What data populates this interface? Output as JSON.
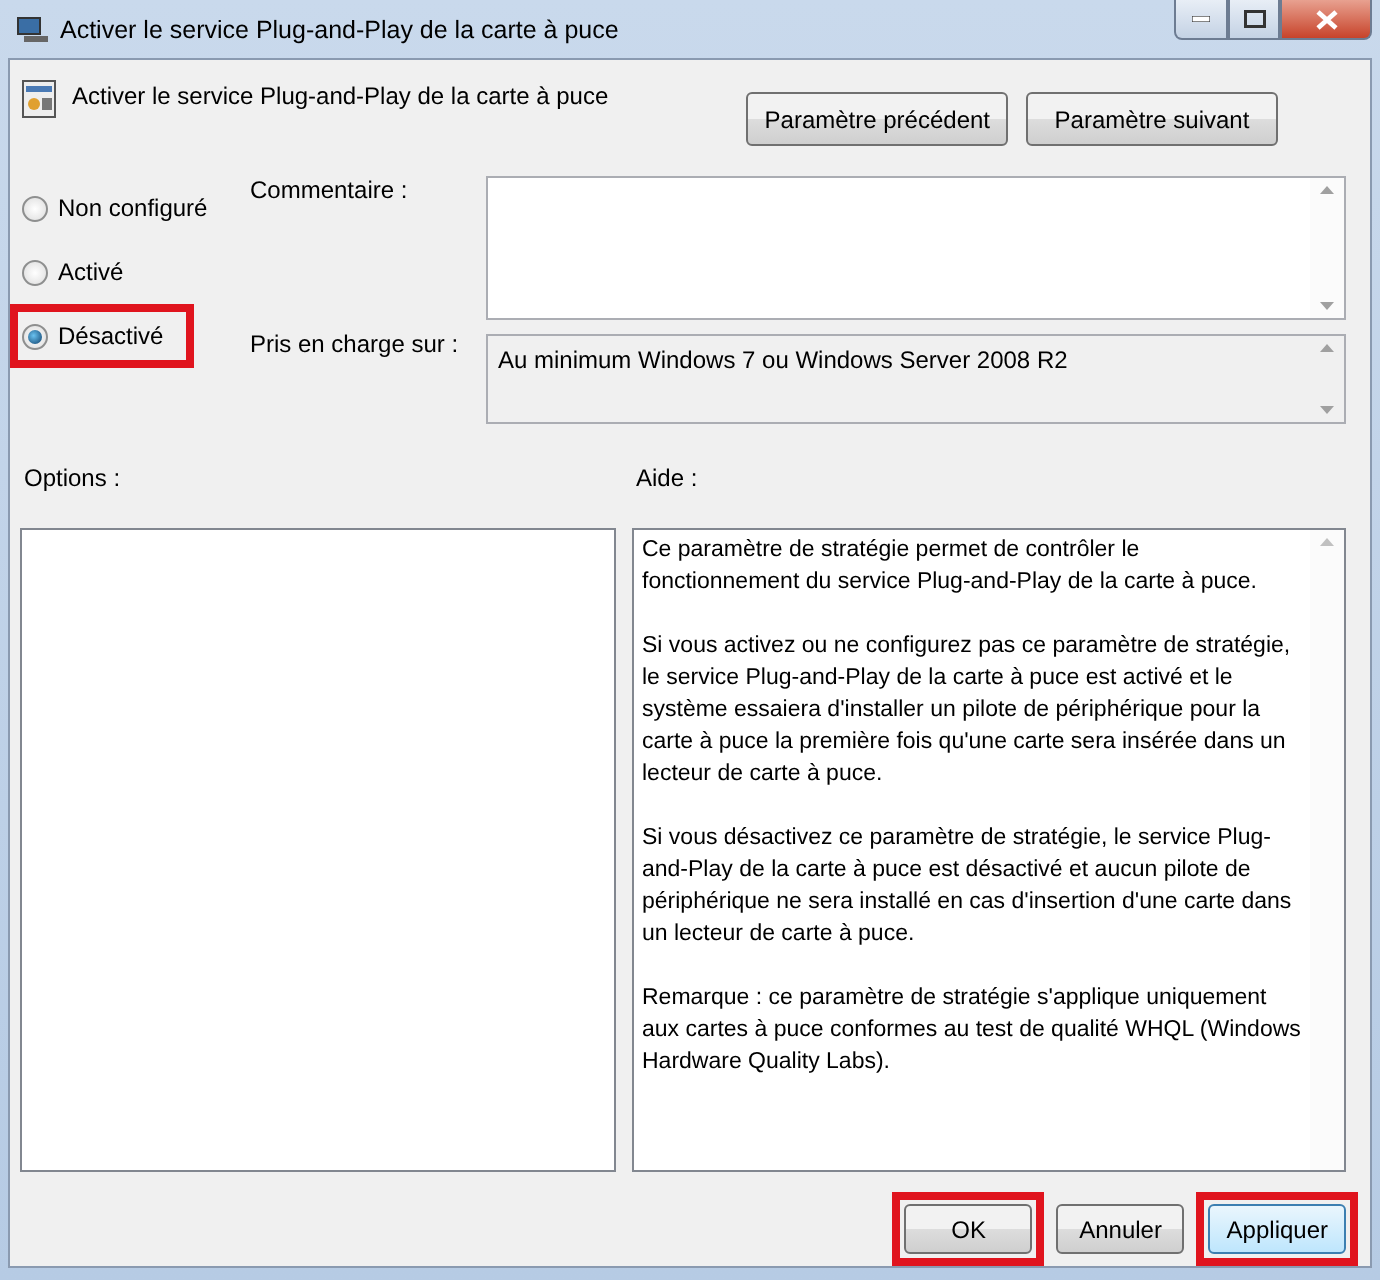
{
  "window": {
    "title": "Activer le service Plug-and-Play de la carte à puce"
  },
  "heading": "Activer le service Plug-and-Play de la carte à puce",
  "nav_buttons": [
    {
      "label": "Paramètre précédent"
    },
    {
      "label": "Paramètre suivant"
    }
  ],
  "state_options": [
    {
      "label": "Non configuré",
      "selected": false,
      "highlighted": false
    },
    {
      "label": "Activé",
      "selected": false,
      "highlighted": false
    },
    {
      "label": "Désactivé",
      "selected": true,
      "highlighted": true
    }
  ],
  "comment": {
    "label": "Commentaire :"
  },
  "supported_on": {
    "label": "Pris en charge sur :",
    "value": "Au minimum Windows 7 ou Windows Server 2008 R2"
  },
  "options": {
    "label": "Options :"
  },
  "help": {
    "label": "Aide :",
    "paragraphs": [
      "Ce paramètre de stratégie permet de contrôler le fonctionnement du service Plug-and-Play de la carte à puce.",
      "Si vous activez ou ne configurez pas ce paramètre de stratégie, le service Plug-and-Play de la carte à puce est activé et le système essaiera d'installer un pilote de périphérique pour la carte à puce la première fois qu'une carte sera insérée dans un lecteur de carte à puce.",
      "Si vous désactivez ce paramètre de stratégie, le service Plug-and-Play de la carte à puce est désactivé et aucun pilote de périphérique ne sera installé en cas d'insertion d'une carte dans un lecteur de carte à puce.",
      "Remarque : ce paramètre de stratégie s'applique uniquement aux cartes à puce conformes au test de qualité WHQL (Windows Hardware Quality Labs)."
    ]
  },
  "dialog_buttons": [
    {
      "label": "OK",
      "highlighted": true,
      "default": false
    },
    {
      "label": "Annuler",
      "highlighted": false,
      "default": false
    },
    {
      "label": "Appliquer",
      "highlighted": true,
      "default": true
    }
  ]
}
